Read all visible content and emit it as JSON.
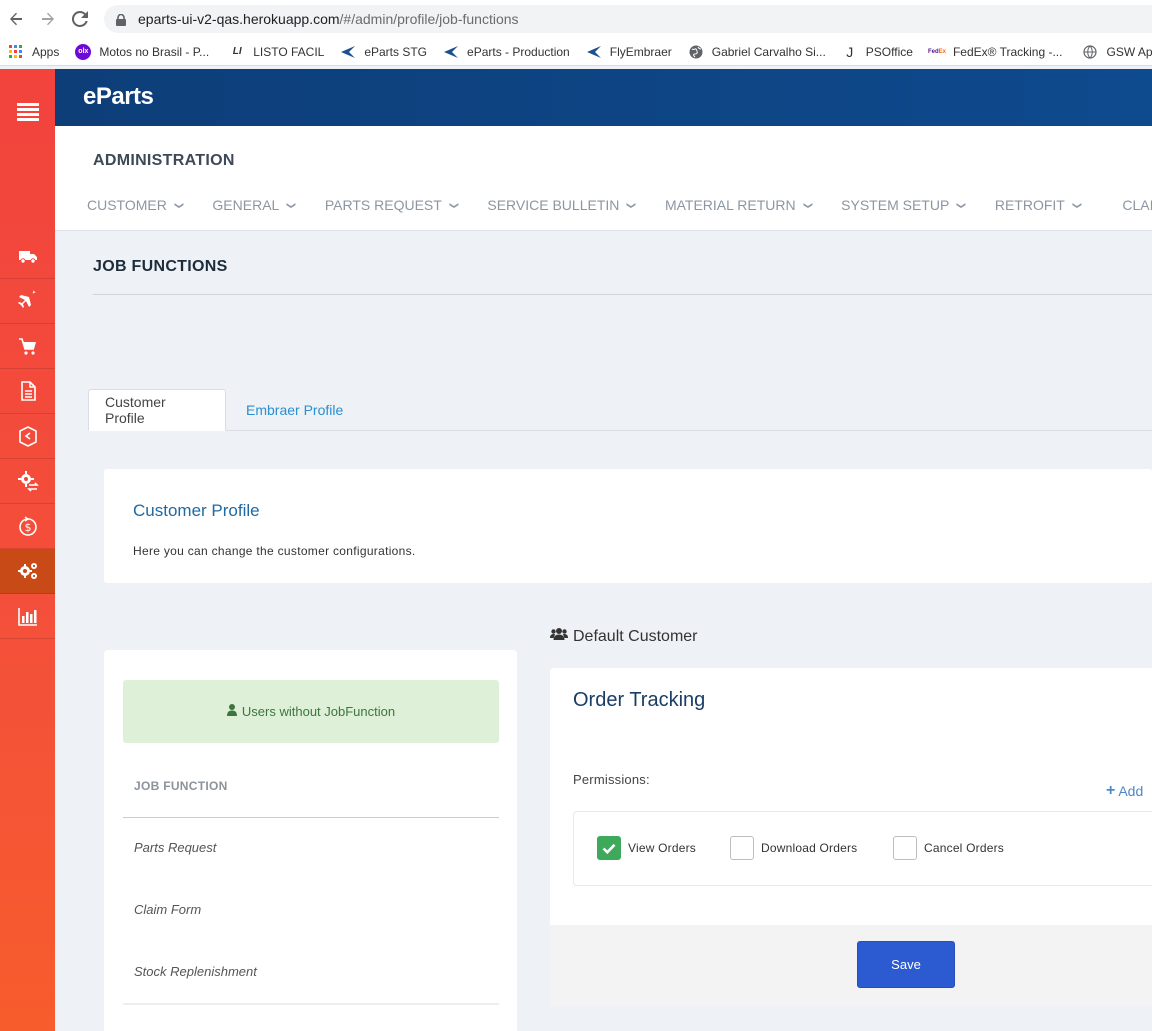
{
  "browser": {
    "url_host": "eparts-ui-v2-qas.herokuapp.com",
    "url_path": "/#/admin/profile/job-functions",
    "bookmarks": [
      {
        "label": "Apps",
        "icon": "apps-grid-icon"
      },
      {
        "label": "Motos no Brasil - P...",
        "icon": "olx-icon"
      },
      {
        "label": "LISTO FACIL",
        "icon": "listo-icon"
      },
      {
        "label": "eParts STG",
        "icon": "embraer-icon"
      },
      {
        "label": "eParts - Production",
        "icon": "embraer-icon"
      },
      {
        "label": "FlyEmbraer",
        "icon": "embraer-icon"
      },
      {
        "label": "Gabriel Carvalho Si...",
        "icon": "globe-icon"
      },
      {
        "label": "PSOffice",
        "icon": "psoffice-icon"
      },
      {
        "label": "FedEx® Tracking -...",
        "icon": "fedex-icon"
      },
      {
        "label": "GSW Applic",
        "icon": "globe-icon"
      }
    ]
  },
  "app": {
    "logo": "eParts"
  },
  "admin": {
    "title": "ADMINISTRATION",
    "menu": [
      "CUSTOMER",
      "GENERAL",
      "PARTS REQUEST",
      "SERVICE BULLETIN",
      "MATERIAL RETURN",
      "SYSTEM SETUP",
      "RETROFIT",
      "CLAIM"
    ]
  },
  "page": {
    "title": "JOB FUNCTIONS",
    "tabs": [
      "Customer Profile",
      "Embraer Profile"
    ],
    "info_card": {
      "title": "Customer Profile",
      "description": "Here you can change the customer configurations."
    }
  },
  "left_panel": {
    "alert": "Users without JobFunction",
    "column_header": "JOB FUNCTION",
    "items": [
      "Parts Request",
      "Claim Form",
      "Stock Replenishment"
    ]
  },
  "right_panel": {
    "heading": "Default Customer",
    "card_title": "Order Tracking",
    "permissions_label": "Permissions:",
    "add_label": "Add",
    "permissions": [
      {
        "label": "View Orders",
        "checked": true
      },
      {
        "label": "Download Orders",
        "checked": false
      },
      {
        "label": "Cancel Orders",
        "checked": false
      }
    ],
    "save_label": "Save"
  },
  "colors": {
    "sidebar": "#f2433d",
    "sidebar_active": "#c84a17",
    "header": "#0d3e78",
    "link": "#2b8fd0",
    "save_button": "#2c5bd1",
    "checkbox_checked": "#3ea85b",
    "alert_bg": "#dff0d8"
  }
}
